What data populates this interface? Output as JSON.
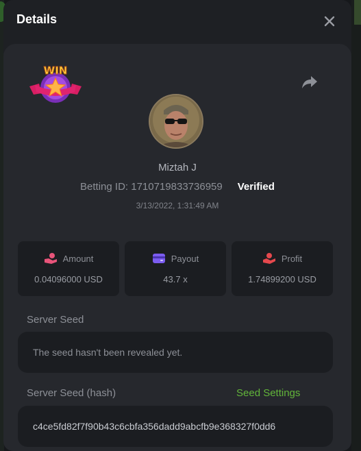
{
  "modal": {
    "title": "Details"
  },
  "bet": {
    "user": "Miztah J",
    "betting_id_text": "Betting ID: 1710719833736959",
    "verified_label": "Verified",
    "datetime": "3/13/2022, 1:31:49 AM"
  },
  "stats": {
    "amount": {
      "label": "Amount",
      "value": "0.04096000 USD",
      "icon": "coins-hand-icon"
    },
    "payout": {
      "label": "Payout",
      "value": "43.7 x",
      "icon": "wallet-card-icon"
    },
    "profit": {
      "label": "Profit",
      "value": "1.74899200 USD",
      "icon": "money-hand-icon"
    }
  },
  "server_seed": {
    "label": "Server Seed",
    "value": "The seed hasn't been revealed yet."
  },
  "server_seed_hash": {
    "label": "Server Seed (hash)",
    "settings_link": "Seed Settings",
    "value": "c4ce5fd82f7f90b43c6cbfa356dadd9abcfb9e368327f0dd6"
  },
  "colors": {
    "accent_green": "#62b53a",
    "payout_purple": "#7b5cf0",
    "profit_red": "#e5484d",
    "amount_pink": "#e8547a"
  },
  "icons": [
    "close-icon",
    "share-icon",
    "win-badge-icon",
    "coins-hand-icon",
    "wallet-card-icon",
    "money-hand-icon"
  ]
}
